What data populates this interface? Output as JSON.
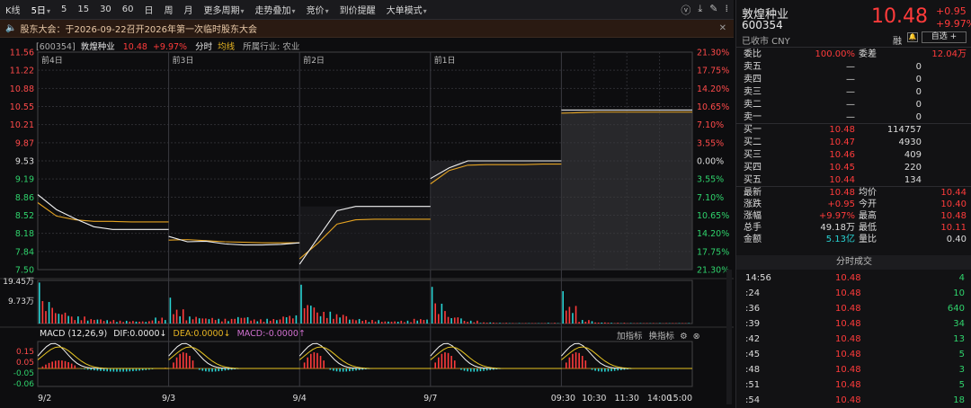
{
  "toolbar": {
    "items": [
      "K线",
      "5日",
      "5",
      "15",
      "30",
      "60",
      "日",
      "周",
      "月",
      "更多周期",
      "走势叠加",
      "竞价",
      "到价提醒",
      "大单模式"
    ]
  },
  "banner": {
    "text": "股东大会：于2026-09-22召开2026年第一次临时股东大会"
  },
  "infobar": {
    "code": "[600354]",
    "name": "敦煌种业",
    "price": "10.48",
    "pct": "+9.97%",
    "tab_fenshi": "分时",
    "tab_junxian": "均线",
    "industry": "所属行业: 农业"
  },
  "main_chart": {
    "y_labels_left": [
      "11.56",
      "11.22",
      "10.88",
      "10.55",
      "10.21",
      "9.87",
      "9.53",
      "9.19",
      "8.86",
      "8.52",
      "8.18",
      "7.84",
      "7.50"
    ],
    "y_labels_right": [
      "21.30%",
      "17.75%",
      "14.20%",
      "10.65%",
      "7.10%",
      "3.55%",
      "0.00%",
      "3.55%",
      "7.10%",
      "10.65%",
      "14.20%",
      "17.75%",
      "21.30%"
    ],
    "day_labels": [
      "前4日",
      "前3日",
      "前2日",
      "前1日"
    ]
  },
  "volume_chart": {
    "y_labels": [
      "19.45万",
      "9.73万"
    ]
  },
  "macd": {
    "title": "MACD (12,26,9)",
    "dif": "DIF:0.0000",
    "dea": "DEA:0.0000",
    "macd": "MACD:-0.0000",
    "y_labels": [
      "0.15",
      "0.05",
      "-0.05",
      "-0.06"
    ],
    "buttons": [
      "加指标",
      "换指标"
    ]
  },
  "x_axis": {
    "labels": [
      "9/2",
      "9/3",
      "9/4",
      "9/7",
      "09:30",
      "10:30",
      "11:30",
      "14:00",
      "15:00"
    ]
  },
  "chart_data": {
    "type": "line",
    "series_price": [
      [
        8.9,
        8.62,
        8.45,
        8.3,
        8.25,
        8.25,
        8.25,
        8.25
      ],
      [
        8.12,
        8.02,
        8.03,
        7.98,
        7.96,
        7.96,
        7.97,
        8.0
      ],
      [
        7.6,
        8.1,
        8.6,
        8.68,
        8.68,
        8.68,
        8.68,
        8.68
      ],
      [
        9.2,
        9.4,
        9.53,
        9.53,
        9.53,
        9.53,
        9.53,
        9.53
      ],
      [
        10.48,
        10.48,
        10.48,
        10.48,
        10.48,
        10.48,
        10.48,
        10.48
      ]
    ],
    "series_avg": [
      [
        8.75,
        8.5,
        8.43,
        8.4,
        8.4,
        8.39,
        8.39,
        8.39
      ],
      [
        8.05,
        8.06,
        8.04,
        8.02,
        8.01,
        8.0,
        8.0,
        8.0
      ],
      [
        7.7,
        8.0,
        8.35,
        8.43,
        8.44,
        8.44,
        8.44,
        8.44
      ],
      [
        9.1,
        9.35,
        9.45,
        9.46,
        9.46,
        9.46,
        9.47,
        9.47
      ],
      [
        10.42,
        10.43,
        10.44,
        10.44,
        10.44,
        10.44,
        10.44,
        10.44
      ]
    ],
    "ylim": [
      7.5,
      11.56
    ]
  },
  "quote": {
    "name": "敦煌种业",
    "code": "600354",
    "status": "已收市 CNY",
    "price": "10.48",
    "change": "+0.95",
    "pct": "+9.97%",
    "rz": "融",
    "zixuan": "自选 +",
    "weibi_label": "委比",
    "weibi": "100.00%",
    "weicha_label": "委差",
    "weicha": "12.04万",
    "asks": [
      {
        "label": "卖五",
        "price": "—",
        "vol": "0"
      },
      {
        "label": "卖四",
        "price": "—",
        "vol": "0"
      },
      {
        "label": "卖三",
        "price": "—",
        "vol": "0"
      },
      {
        "label": "卖二",
        "price": "—",
        "vol": "0"
      },
      {
        "label": "卖一",
        "price": "—",
        "vol": "0"
      }
    ],
    "bids": [
      {
        "label": "买一",
        "price": "10.48",
        "vol": "114757"
      },
      {
        "label": "买二",
        "price": "10.47",
        "vol": "4930"
      },
      {
        "label": "买三",
        "price": "10.46",
        "vol": "409"
      },
      {
        "label": "买四",
        "price": "10.45",
        "vol": "220"
      },
      {
        "label": "买五",
        "price": "10.44",
        "vol": "134"
      }
    ],
    "stats": [
      {
        "l1": "最新",
        "v1": "10.48",
        "l2": "均价",
        "v2": "10.44",
        "c1": "red",
        "c2": "red"
      },
      {
        "l1": "涨跌",
        "v1": "+0.95",
        "l2": "今开",
        "v2": "10.40",
        "c1": "red",
        "c2": "red"
      },
      {
        "l1": "涨幅",
        "v1": "+9.97%",
        "l2": "最高",
        "v2": "10.48",
        "c1": "red",
        "c2": "red"
      },
      {
        "l1": "总手",
        "v1": "49.18万",
        "l2": "最低",
        "v2": "10.11",
        "c1": "white",
        "c2": "red"
      },
      {
        "l1": "金额",
        "v1": "5.13亿",
        "l2": "量比",
        "v2": "0.40",
        "c1": "cyan",
        "c2": "white"
      }
    ]
  },
  "ticks": {
    "header": "分时成交",
    "rows": [
      {
        "t": "14:56",
        "p": "10.48",
        "v": "4"
      },
      {
        "t": ":24",
        "p": "10.48",
        "v": "10"
      },
      {
        "t": ":36",
        "p": "10.48",
        "v": "640"
      },
      {
        "t": ":39",
        "p": "10.48",
        "v": "34"
      },
      {
        "t": ":42",
        "p": "10.48",
        "v": "13"
      },
      {
        "t": ":45",
        "p": "10.48",
        "v": "5"
      },
      {
        "t": ":48",
        "p": "10.48",
        "v": "3"
      },
      {
        "t": ":51",
        "p": "10.48",
        "v": "5"
      },
      {
        "t": ":54",
        "p": "10.48",
        "v": "18"
      }
    ]
  }
}
